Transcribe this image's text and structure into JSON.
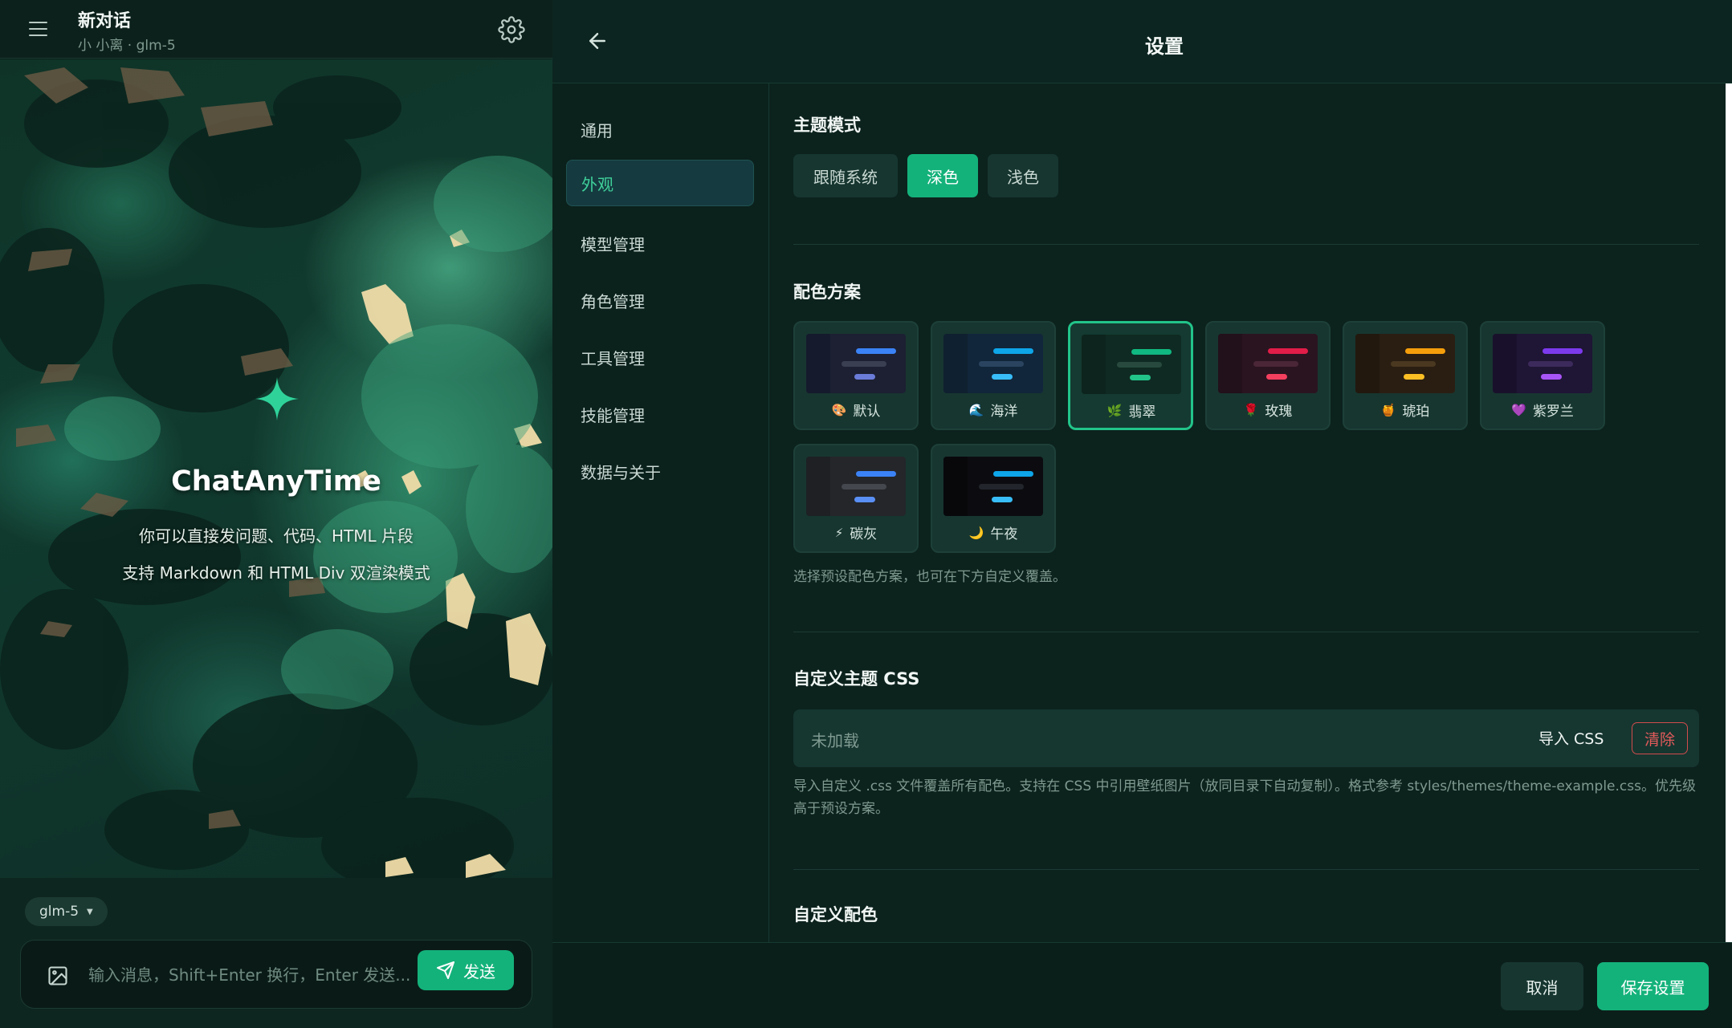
{
  "chat": {
    "title": "新对话",
    "subtitle": "小 小离 · glm-5",
    "welcome": {
      "title": "ChatAnyTime",
      "line1": "你可以直接发问题、代码、HTML 片段",
      "line2": "支持 Markdown 和 HTML Div 双渲染模式"
    },
    "model_chip": "glm-5",
    "input_placeholder": "输入消息，Shift+Enter 换行，Enter 发送...",
    "send_label": "发送"
  },
  "settings": {
    "title": "设置",
    "nav": [
      {
        "label": "通用"
      },
      {
        "label": "外观"
      },
      {
        "label": "模型管理"
      },
      {
        "label": "角色管理"
      },
      {
        "label": "工具管理"
      },
      {
        "label": "技能管理"
      },
      {
        "label": "数据与关于"
      }
    ],
    "active_nav": "外观",
    "theme_mode": {
      "title": "主题模式",
      "options": [
        {
          "label": "跟随系统"
        },
        {
          "label": "深色"
        },
        {
          "label": "浅色"
        }
      ],
      "selected": "深色"
    },
    "color_scheme": {
      "title": "配色方案",
      "selected": "翡翠",
      "items": [
        {
          "label": "默认",
          "icon": "🎨",
          "bg": "#1c2032",
          "side": "#151a2c",
          "accent": "#3b82f6",
          "accent2": "#6a7bd8",
          "muted": "#3a4052"
        },
        {
          "label": "海洋",
          "icon": "🌊",
          "bg": "#11263a",
          "side": "#0f2030",
          "accent": "#0ea5e9",
          "accent2": "#38bdf8",
          "muted": "#2a4460"
        },
        {
          "label": "翡翠",
          "icon": "🌿",
          "bg": "#0f2a22",
          "side": "#0c241d",
          "accent": "#10b981",
          "accent2": "#22c48a",
          "muted": "#284a3e"
        },
        {
          "label": "玫瑰",
          "icon": "🌹",
          "bg": "#2a1420",
          "side": "#22101a",
          "accent": "#e11d48",
          "accent2": "#f43f5e",
          "muted": "#4a2636"
        },
        {
          "label": "琥珀",
          "icon": "🍯",
          "bg": "#2a1e12",
          "side": "#22180e",
          "accent": "#f59e0b",
          "accent2": "#fbbf24",
          "muted": "#4a3820"
        },
        {
          "label": "紫罗兰",
          "icon": "💜",
          "bg": "#1f1535",
          "side": "#19112c",
          "accent": "#7c3aed",
          "accent2": "#a855f7",
          "muted": "#3c2a5c"
        },
        {
          "label": "碳灰",
          "icon": "⚡",
          "bg": "#24262a",
          "side": "#1e2024",
          "accent": "#3b82f6",
          "accent2": "#5a8ff5",
          "muted": "#44474d"
        },
        {
          "label": "午夜",
          "icon": "🌙",
          "bg": "#0c0c10",
          "side": "#08080b",
          "accent": "#0ea5e9",
          "accent2": "#38bdf8",
          "muted": "#22252c"
        }
      ],
      "hint": "选择预设配色方案，也可在下方自定义覆盖。"
    },
    "custom_css": {
      "title": "自定义主题 CSS",
      "status": "未加载",
      "import_label": "导入 CSS",
      "clear_label": "清除",
      "hint": "导入自定义 .css 文件覆盖所有配色。支持在 CSS 中引用壁纸图片（放同目录下自动复制）。格式参考 styles/themes/theme-example.css。优先级高于预设方案。"
    },
    "custom_colors": {
      "title": "自定义配色"
    },
    "cancel_label": "取消",
    "save_label": "保存设置"
  },
  "colors": {
    "accent": "#14b27b",
    "danger": "#e25b5b"
  }
}
